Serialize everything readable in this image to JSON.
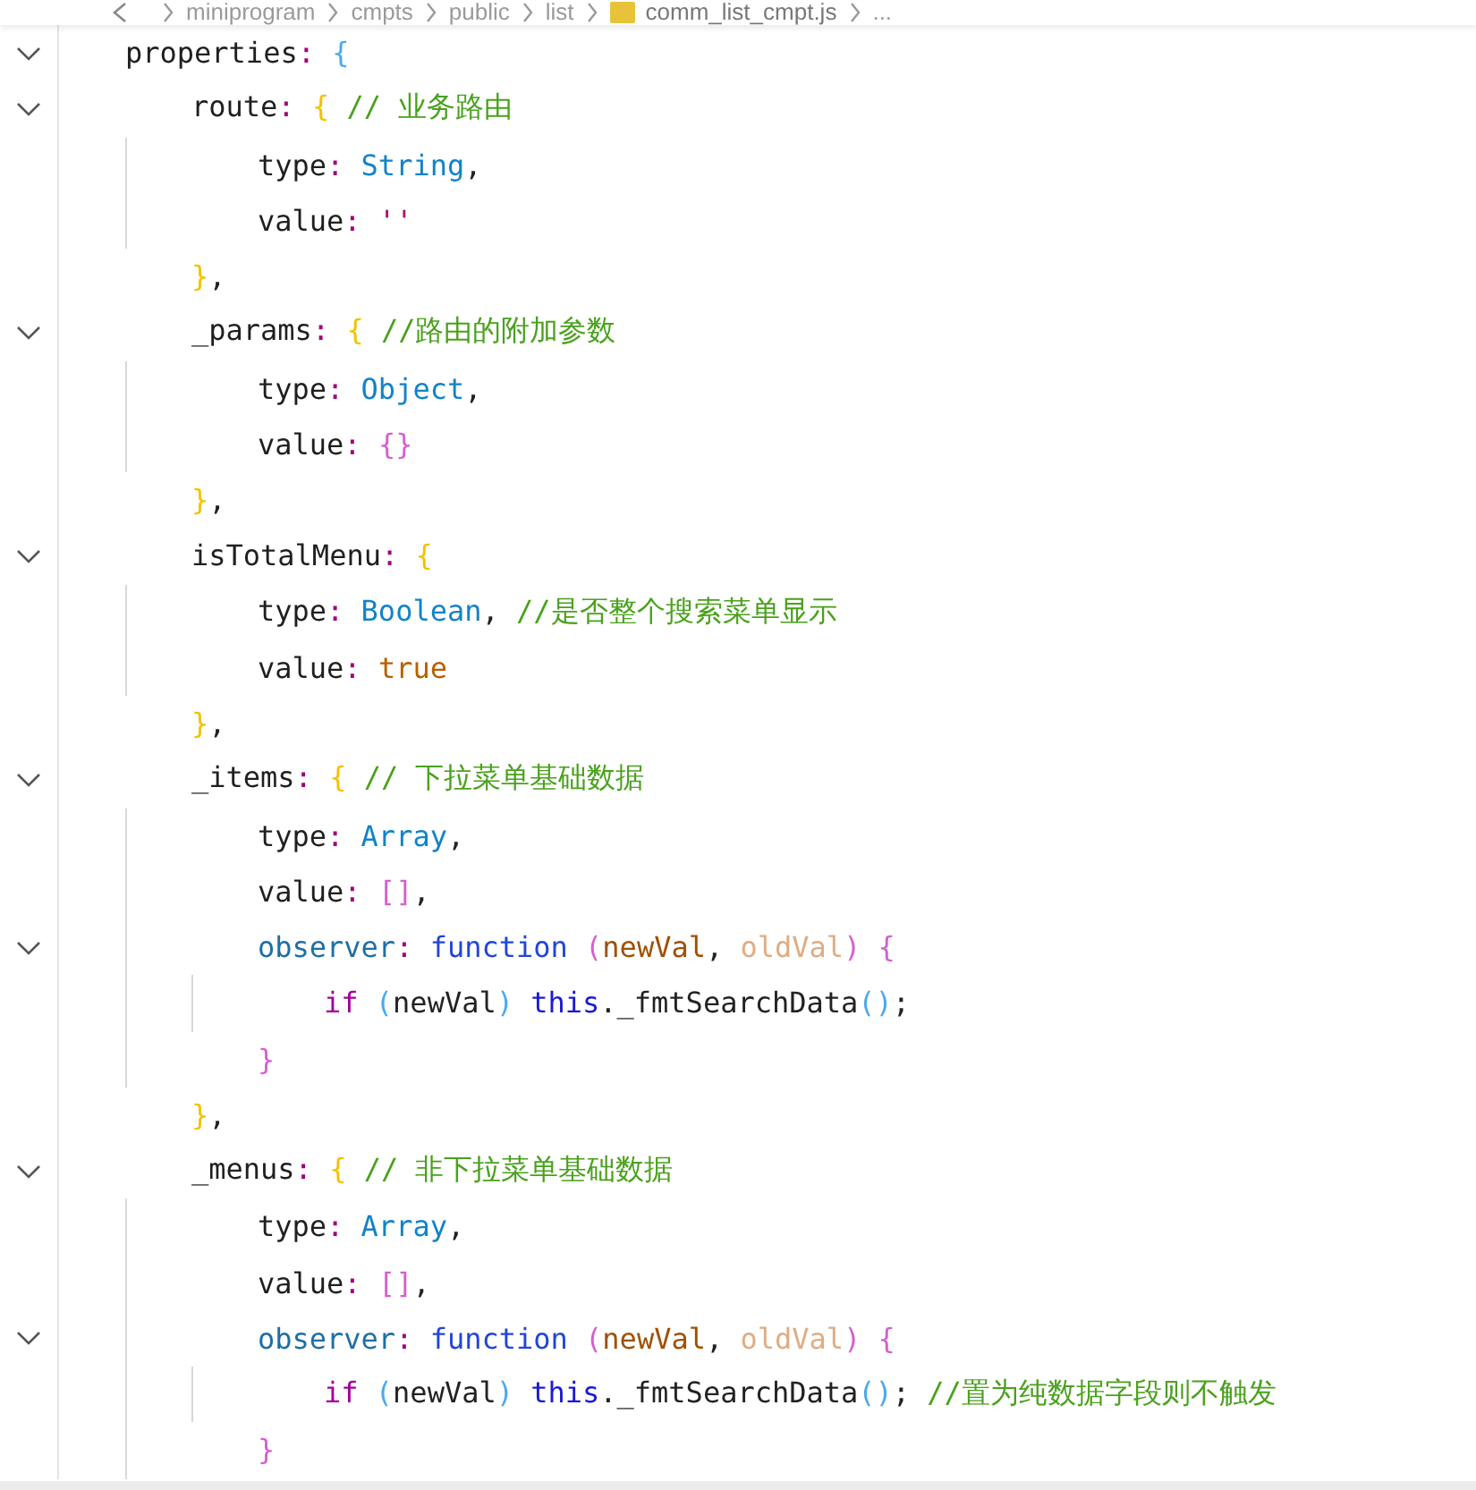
{
  "breadcrumb": [
    {
      "kind": "folder",
      "text": "miniprogram"
    },
    {
      "kind": "folder",
      "text": "cmpts"
    },
    {
      "kind": "folder",
      "text": "public"
    },
    {
      "kind": "folder",
      "text": "list"
    },
    {
      "kind": "file",
      "text": "comm_list_cmpt.js"
    },
    {
      "kind": "more",
      "text": "..."
    }
  ],
  "code": [
    {
      "expanded": true,
      "tokens": [
        {
          "kind": "key",
          "text": "properties"
        },
        {
          "kind": "colon",
          "text": ": "
        },
        {
          "kind": "brace1",
          "text": "{"
        }
      ],
      "children": [
        {
          "expanded": true,
          "tokens": [
            {
              "kind": "key",
              "text": "route"
            },
            {
              "kind": "colon",
              "text": ": "
            },
            {
              "kind": "brace2",
              "text": "{ "
            },
            {
              "kind": "comment",
              "text": "// 业务路由"
            }
          ],
          "children": [
            {
              "tokens": [
                {
                  "kind": "key",
                  "text": "type"
                },
                {
                  "kind": "colon",
                  "text": ": "
                },
                {
                  "kind": "type",
                  "text": "String"
                },
                {
                  "kind": "plain",
                  "text": ","
                }
              ]
            },
            {
              "tokens": [
                {
                  "kind": "key",
                  "text": "value"
                },
                {
                  "kind": "colon",
                  "text": ": "
                },
                {
                  "kind": "string",
                  "text": "''"
                }
              ]
            }
          ],
          "close": [
            {
              "kind": "brace2",
              "text": "}"
            },
            {
              "kind": "plain",
              "text": ","
            }
          ]
        },
        {
          "expanded": true,
          "tokens": [
            {
              "kind": "key",
              "text": "_params"
            },
            {
              "kind": "colon",
              "text": ": "
            },
            {
              "kind": "brace2",
              "text": "{ "
            },
            {
              "kind": "comment",
              "text": "//路由的附加参数"
            }
          ],
          "children": [
            {
              "tokens": [
                {
                  "kind": "key",
                  "text": "type"
                },
                {
                  "kind": "colon",
                  "text": ": "
                },
                {
                  "kind": "type",
                  "text": "Object"
                },
                {
                  "kind": "plain",
                  "text": ","
                }
              ]
            },
            {
              "tokens": [
                {
                  "kind": "key",
                  "text": "value"
                },
                {
                  "kind": "colon",
                  "text": ": "
                },
                {
                  "kind": "brace3",
                  "text": "{}"
                }
              ]
            }
          ],
          "close": [
            {
              "kind": "brace2",
              "text": "}"
            },
            {
              "kind": "plain",
              "text": ","
            }
          ]
        },
        {
          "expanded": true,
          "tokens": [
            {
              "kind": "key",
              "text": "isTotalMenu"
            },
            {
              "kind": "colon",
              "text": ": "
            },
            {
              "kind": "brace2",
              "text": "{"
            }
          ],
          "children": [
            {
              "tokens": [
                {
                  "kind": "key",
                  "text": "type"
                },
                {
                  "kind": "colon",
                  "text": ": "
                },
                {
                  "kind": "type",
                  "text": "Boolean"
                },
                {
                  "kind": "plain",
                  "text": ", "
                },
                {
                  "kind": "comment",
                  "text": "//是否整个搜索菜单显示"
                }
              ]
            },
            {
              "tokens": [
                {
                  "kind": "key",
                  "text": "value"
                },
                {
                  "kind": "colon",
                  "text": ": "
                },
                {
                  "kind": "bool",
                  "text": "true"
                }
              ]
            }
          ],
          "close": [
            {
              "kind": "brace2",
              "text": "}"
            },
            {
              "kind": "plain",
              "text": ","
            }
          ]
        },
        {
          "expanded": true,
          "tokens": [
            {
              "kind": "key",
              "text": "_items"
            },
            {
              "kind": "colon",
              "text": ": "
            },
            {
              "kind": "brace2",
              "text": "{ "
            },
            {
              "kind": "comment",
              "text": "// 下拉菜单基础数据"
            }
          ],
          "children": [
            {
              "tokens": [
                {
                  "kind": "key",
                  "text": "type"
                },
                {
                  "kind": "colon",
                  "text": ": "
                },
                {
                  "kind": "type",
                  "text": "Array"
                },
                {
                  "kind": "plain",
                  "text": ","
                }
              ]
            },
            {
              "tokens": [
                {
                  "kind": "key",
                  "text": "value"
                },
                {
                  "kind": "colon",
                  "text": ": "
                },
                {
                  "kind": "brace3",
                  "text": "[]"
                },
                {
                  "kind": "plain",
                  "text": ","
                }
              ]
            },
            {
              "expanded": true,
              "tokens": [
                {
                  "kind": "prop",
                  "text": "observer"
                },
                {
                  "kind": "colon",
                  "text": ": "
                },
                {
                  "kind": "keyword",
                  "text": "function "
                },
                {
                  "kind": "brace3",
                  "text": "("
                },
                {
                  "kind": "param",
                  "text": "newVal"
                },
                {
                  "kind": "plain",
                  "text": ", "
                },
                {
                  "kind": "unused",
                  "text": "oldVal"
                },
                {
                  "kind": "brace3",
                  "text": ") {"
                }
              ],
              "children": [
                {
                  "tokens": [
                    {
                      "kind": "control",
                      "text": "if "
                    },
                    {
                      "kind": "brace1",
                      "text": "("
                    },
                    {
                      "kind": "plain",
                      "text": "newVal"
                    },
                    {
                      "kind": "brace1",
                      "text": ") "
                    },
                    {
                      "kind": "this",
                      "text": "this"
                    },
                    {
                      "kind": "plain",
                      "text": "._fmtSearchData"
                    },
                    {
                      "kind": "brace1",
                      "text": "()"
                    },
                    {
                      "kind": "plain",
                      "text": ";"
                    }
                  ]
                }
              ],
              "close": [
                {
                  "kind": "brace3",
                  "text": "}"
                }
              ]
            }
          ],
          "close": [
            {
              "kind": "brace2",
              "text": "}"
            },
            {
              "kind": "plain",
              "text": ","
            }
          ]
        },
        {
          "expanded": true,
          "tokens": [
            {
              "kind": "key",
              "text": "_menus"
            },
            {
              "kind": "colon",
              "text": ": "
            },
            {
              "kind": "brace2",
              "text": "{ "
            },
            {
              "kind": "comment",
              "text": "// 非下拉菜单基础数据"
            }
          ],
          "children": [
            {
              "tokens": [
                {
                  "kind": "key",
                  "text": "type"
                },
                {
                  "kind": "colon",
                  "text": ": "
                },
                {
                  "kind": "type",
                  "text": "Array"
                },
                {
                  "kind": "plain",
                  "text": ","
                }
              ]
            },
            {
              "tokens": [
                {
                  "kind": "key",
                  "text": "value"
                },
                {
                  "kind": "colon",
                  "text": ": "
                },
                {
                  "kind": "brace3",
                  "text": "[]"
                },
                {
                  "kind": "plain",
                  "text": ","
                }
              ]
            },
            {
              "expanded": true,
              "tokens": [
                {
                  "kind": "prop",
                  "text": "observer"
                },
                {
                  "kind": "colon",
                  "text": ": "
                },
                {
                  "kind": "keyword",
                  "text": "function "
                },
                {
                  "kind": "brace3",
                  "text": "("
                },
                {
                  "kind": "param",
                  "text": "newVal"
                },
                {
                  "kind": "plain",
                  "text": ", "
                },
                {
                  "kind": "unused",
                  "text": "oldVal"
                },
                {
                  "kind": "brace3",
                  "text": ") {"
                }
              ],
              "children": [
                {
                  "tokens": [
                    {
                      "kind": "control",
                      "text": "if "
                    },
                    {
                      "kind": "brace1",
                      "text": "("
                    },
                    {
                      "kind": "plain",
                      "text": "newVal"
                    },
                    {
                      "kind": "brace1",
                      "text": ") "
                    },
                    {
                      "kind": "this",
                      "text": "this"
                    },
                    {
                      "kind": "plain",
                      "text": "._fmtSearchData"
                    },
                    {
                      "kind": "brace1",
                      "text": "()"
                    },
                    {
                      "kind": "plain",
                      "text": "; "
                    },
                    {
                      "kind": "comment",
                      "text": "//置为纯数据字段则不触发"
                    }
                  ]
                }
              ],
              "close": [
                {
                  "kind": "brace3",
                  "text": "}"
                }
              ]
            }
          ]
        }
      ]
    }
  ]
}
